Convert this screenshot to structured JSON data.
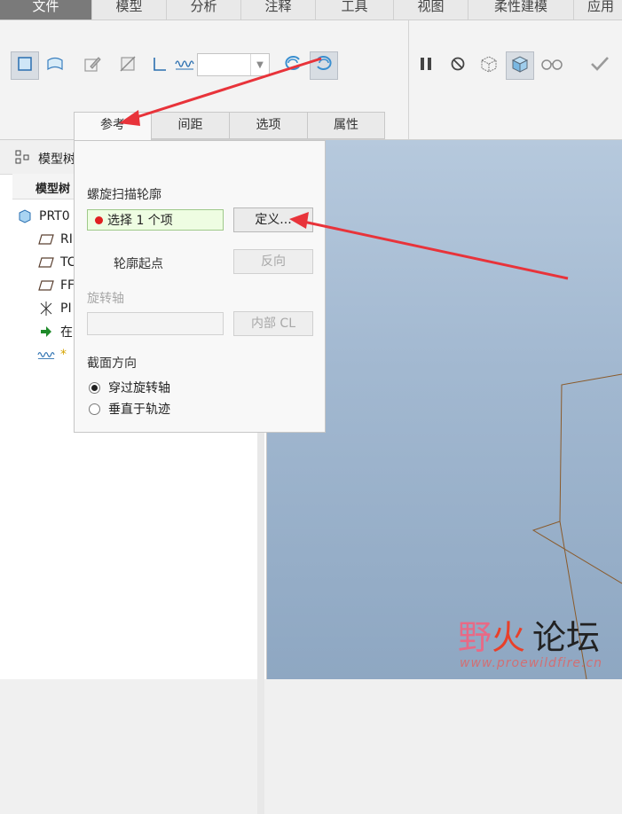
{
  "menu_tabs": [
    "文件",
    "模型",
    "分析",
    "注释",
    "工具",
    "视图",
    "柔性建模",
    "应用"
  ],
  "dialog_tabs": [
    "参考",
    "间距",
    "选项",
    "属性"
  ],
  "model_tree": {
    "header": "模型树",
    "column_header": "模型树",
    "items": [
      {
        "label": "PRT0",
        "icon": "part-icon"
      },
      {
        "label": "RI",
        "icon": "datum-plane-icon"
      },
      {
        "label": "TC",
        "icon": "datum-plane-icon"
      },
      {
        "label": "FF",
        "icon": "datum-plane-icon"
      },
      {
        "label": "PI",
        "icon": "coordinate-system-icon"
      },
      {
        "label": "在",
        "icon": "insert-here-arrow-icon"
      },
      {
        "label": "*",
        "icon": "helical-sweep-feature-icon"
      }
    ]
  },
  "dialog": {
    "profile_label": "螺旋扫描轮廓",
    "collector_text": "选择 1 个项",
    "define_button": "定义...",
    "profile_start_label": "轮廓起点",
    "flip_button": "反向",
    "axis_label": "旋转轴",
    "internal_cl_button": "内部 CL",
    "section_orientation_label": "截面方向",
    "radio_options": [
      {
        "label": "穿过旋转轴",
        "selected": true
      },
      {
        "label": "垂直于轨迹",
        "selected": false
      }
    ]
  },
  "watermark": {
    "text_a": "野",
    "text_b": "火",
    "text_c": "论坛",
    "url": "www.proewildfire.cn"
  },
  "colors": {
    "accent_arrow": "#e8333a",
    "selected_dot": "#e02020",
    "collector_bg": "#eefde2",
    "viewport_top": "#b6c9dd",
    "viewport_bottom": "#8ea7c2",
    "geometry_line": "#8a5a2a"
  }
}
